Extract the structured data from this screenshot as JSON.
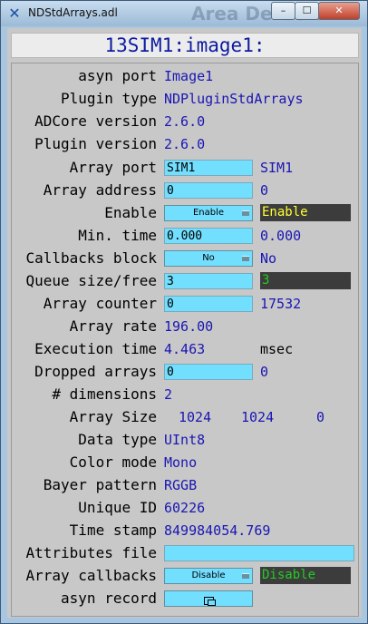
{
  "window": {
    "title": "NDStdArrays.adl",
    "background_title": "Area Detecto",
    "min": "–",
    "max": "☐",
    "close": "✕",
    "app_icon": "✕"
  },
  "header": "13SIM1:image1:",
  "rows": {
    "asyn_port": {
      "label": "asyn port",
      "value": "Image1"
    },
    "plugin_type": {
      "label": "Plugin type",
      "value": "NDPluginStdArrays"
    },
    "adcore_version": {
      "label": "ADCore version",
      "value": "2.6.0"
    },
    "plugin_version": {
      "label": "Plugin version",
      "value": "2.6.0"
    },
    "array_port": {
      "label": "Array port",
      "input": "SIM1",
      "readback": "SIM1"
    },
    "array_address": {
      "label": "Array address",
      "input": "0",
      "readback": "0"
    },
    "enable": {
      "label": "Enable",
      "menu": "Enable",
      "status": "Enable",
      "status_color": "#ffff33"
    },
    "min_time": {
      "label": "Min. time",
      "input": "0.000",
      "readback": "0.000"
    },
    "callbacks_block": {
      "label": "Callbacks block",
      "menu": "No",
      "readback": "No"
    },
    "queue_size": {
      "label": "Queue size/free",
      "input": "3",
      "status": "3",
      "status_color": "#22cc22"
    },
    "array_counter": {
      "label": "Array counter",
      "input": "0",
      "readback": "17532"
    },
    "array_rate": {
      "label": "Array rate",
      "value": "196.00"
    },
    "execution_time": {
      "label": "Execution time",
      "value": "4.463",
      "unit": "msec"
    },
    "dropped_arrays": {
      "label": "Dropped arrays",
      "input": "0",
      "readback": "0"
    },
    "dimensions": {
      "label": "# dimensions",
      "value": "2"
    },
    "array_size": {
      "label": "Array Size",
      "values": [
        "1024",
        "1024",
        "0"
      ]
    },
    "data_type": {
      "label": "Data type",
      "value": "UInt8"
    },
    "color_mode": {
      "label": "Color mode",
      "value": "Mono"
    },
    "bayer_pattern": {
      "label": "Bayer pattern",
      "value": "RGGB"
    },
    "unique_id": {
      "label": "Unique ID",
      "value": "60226"
    },
    "time_stamp": {
      "label": "Time stamp",
      "value": "849984054.769"
    },
    "attributes_file": {
      "label": "Attributes file",
      "input": ""
    },
    "array_callbacks": {
      "label": "Array callbacks",
      "menu": "Disable",
      "status": "Disable",
      "status_color": "#22cc22"
    },
    "asyn_record": {
      "label": "asyn record",
      "icon": "related-display-icon"
    }
  }
}
